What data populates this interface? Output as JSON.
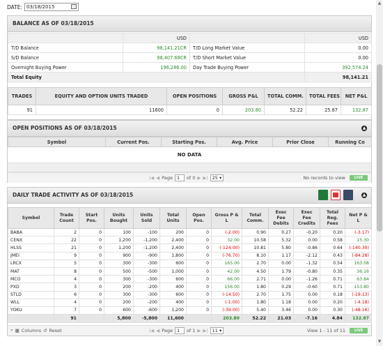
{
  "date": {
    "label": "DATE:",
    "value": "03/18/2015"
  },
  "balance": {
    "title": "BALANCE AS OF 03/18/2015",
    "currency": "USD",
    "rows": [
      {
        "l_label": "T/D Balance",
        "l_val": "98,141.21CR",
        "r_label": "T/D Long Market Value",
        "r_val": "0.00"
      },
      {
        "l_label": "S/D Balance",
        "l_val": "98,407.68CR",
        "r_label": "T/D Short Market Value",
        "r_val": "0.00"
      },
      {
        "l_label": "Overnight Buying Power",
        "l_val": "196,286.00",
        "r_label": "Day Trade Buying Power",
        "r_val": "392,574.24"
      }
    ],
    "total_label": "Total Equity",
    "total_val": "98,141.21"
  },
  "trades": {
    "headers": [
      "TRADES",
      "EQUITY AND OPTION UNITS TRADED",
      "OPEN POSITIONS",
      "GROSS P&L",
      "TOTAL COMM.",
      "TOTAL FEES",
      "NET P&L"
    ],
    "values": [
      "91",
      "11600",
      "0",
      "203.80",
      "52.22",
      "25.87",
      "132.87"
    ]
  },
  "open_positions": {
    "title": "OPEN POSITIONS AS OF 03/18/2015",
    "headers": [
      "Symbol",
      "Current Pos.",
      "Starting Pos.",
      "Avg. Price",
      "Prior Close",
      "Running Co"
    ],
    "no_data": "NO DATA",
    "pager": {
      "page_label": "Page",
      "page": "1",
      "of_label": "of 0",
      "per_page": "25",
      "status": "No records to view",
      "live": "LIVE"
    }
  },
  "daily": {
    "title": "DAILY TRADE ACTIVITY AS OF 03/18/2015",
    "headers": [
      "Symbol",
      "Trade Count",
      "Start Pos.",
      "Units Bought",
      "Units Sold",
      "Total Units",
      "Open Pos.",
      "Gross P & L",
      "Total Comm.",
      "Exec Fee Debits",
      "Exec Fee Credits",
      "Total Reg. Fees",
      "Net P & L"
    ],
    "rows": [
      [
        "BABA",
        "2",
        "0",
        "100",
        "-100",
        "200",
        "0",
        "(-2.00)",
        "0.90",
        "0.27",
        "-0.20",
        "0.20",
        "(-3.17)"
      ],
      [
        "CENX",
        "22",
        "0",
        "1,200",
        "-1,200",
        "2,400",
        "0",
        "32.00",
        "10.58",
        "5.32",
        "0.00",
        "0.58",
        "15.30"
      ],
      [
        "HLSS",
        "21",
        "0",
        "1,200",
        "-1,200",
        "2,400",
        "0",
        "(-124.00)",
        "10.81",
        "5.80",
        "-0.86",
        "0.64",
        "(-140.39)"
      ],
      [
        "JMEI",
        "9",
        "0",
        "900",
        "-900",
        "1,800",
        "0",
        "(-76.70)",
        "8.10",
        "1.17",
        "-2.12",
        "0.43",
        "(-84.28)"
      ],
      [
        "LRCX",
        "5",
        "0",
        "300",
        "-300",
        "600",
        "0",
        "165.00",
        "2.70",
        "0.00",
        "-1.32",
        "0.54",
        "163.08"
      ],
      [
        "MAT",
        "8",
        "0",
        "500",
        "-500",
        "1,000",
        "0",
        "42.00",
        "4.50",
        "1.79",
        "-0.80",
        "0.35",
        "36.16"
      ],
      [
        "MCO",
        "4",
        "0",
        "300",
        "-300",
        "600",
        "0",
        "66.00",
        "2.71",
        "0.00",
        "-1.26",
        "0.71",
        "63.84"
      ],
      [
        "PXD",
        "3",
        "0",
        "200",
        "-200",
        "400",
        "0",
        "156.00",
        "1.80",
        "0.29",
        "-0.60",
        "0.71",
        "153.80"
      ],
      [
        "STLD",
        "6",
        "0",
        "300",
        "-300",
        "600",
        "0",
        "(-14.50)",
        "2.70",
        "1.75",
        "0.00",
        "0.18",
        "(-19.13)"
      ],
      [
        "WLL",
        "4",
        "0",
        "200",
        "-200",
        "400",
        "0",
        "(-1.00)",
        "1.80",
        "1.18",
        "0.00",
        "0.20",
        "(-4.18)"
      ],
      [
        "YOKU",
        "7",
        "0",
        "600",
        "-600",
        "1,200",
        "0",
        "(-39.00)",
        "5.40",
        "3.46",
        "0.00",
        "0.30",
        "(-48.16)"
      ]
    ],
    "total": [
      "",
      "91",
      "",
      "5,800",
      "-5,800",
      "11,600",
      "",
      "203.80",
      "52.22",
      "21.03",
      "-7.16",
      "4.84",
      "132.87"
    ],
    "pager": {
      "columns": "Columns",
      "reset": "Reset",
      "page_label": "Page",
      "page": "1",
      "of_label": "of 1",
      "per_page": "11",
      "status": "View 1 - 11 of 11",
      "live": "LIVE"
    }
  },
  "icons": [
    "calendar-icon",
    "collapse-icon",
    "excel-icon",
    "pdf-icon",
    "print-icon",
    "search-icon",
    "columns-icon",
    "reset-icon"
  ],
  "colors": {
    "positive": "#2e8b2e",
    "negative": "#dd0000",
    "live": "#7bc97b"
  }
}
